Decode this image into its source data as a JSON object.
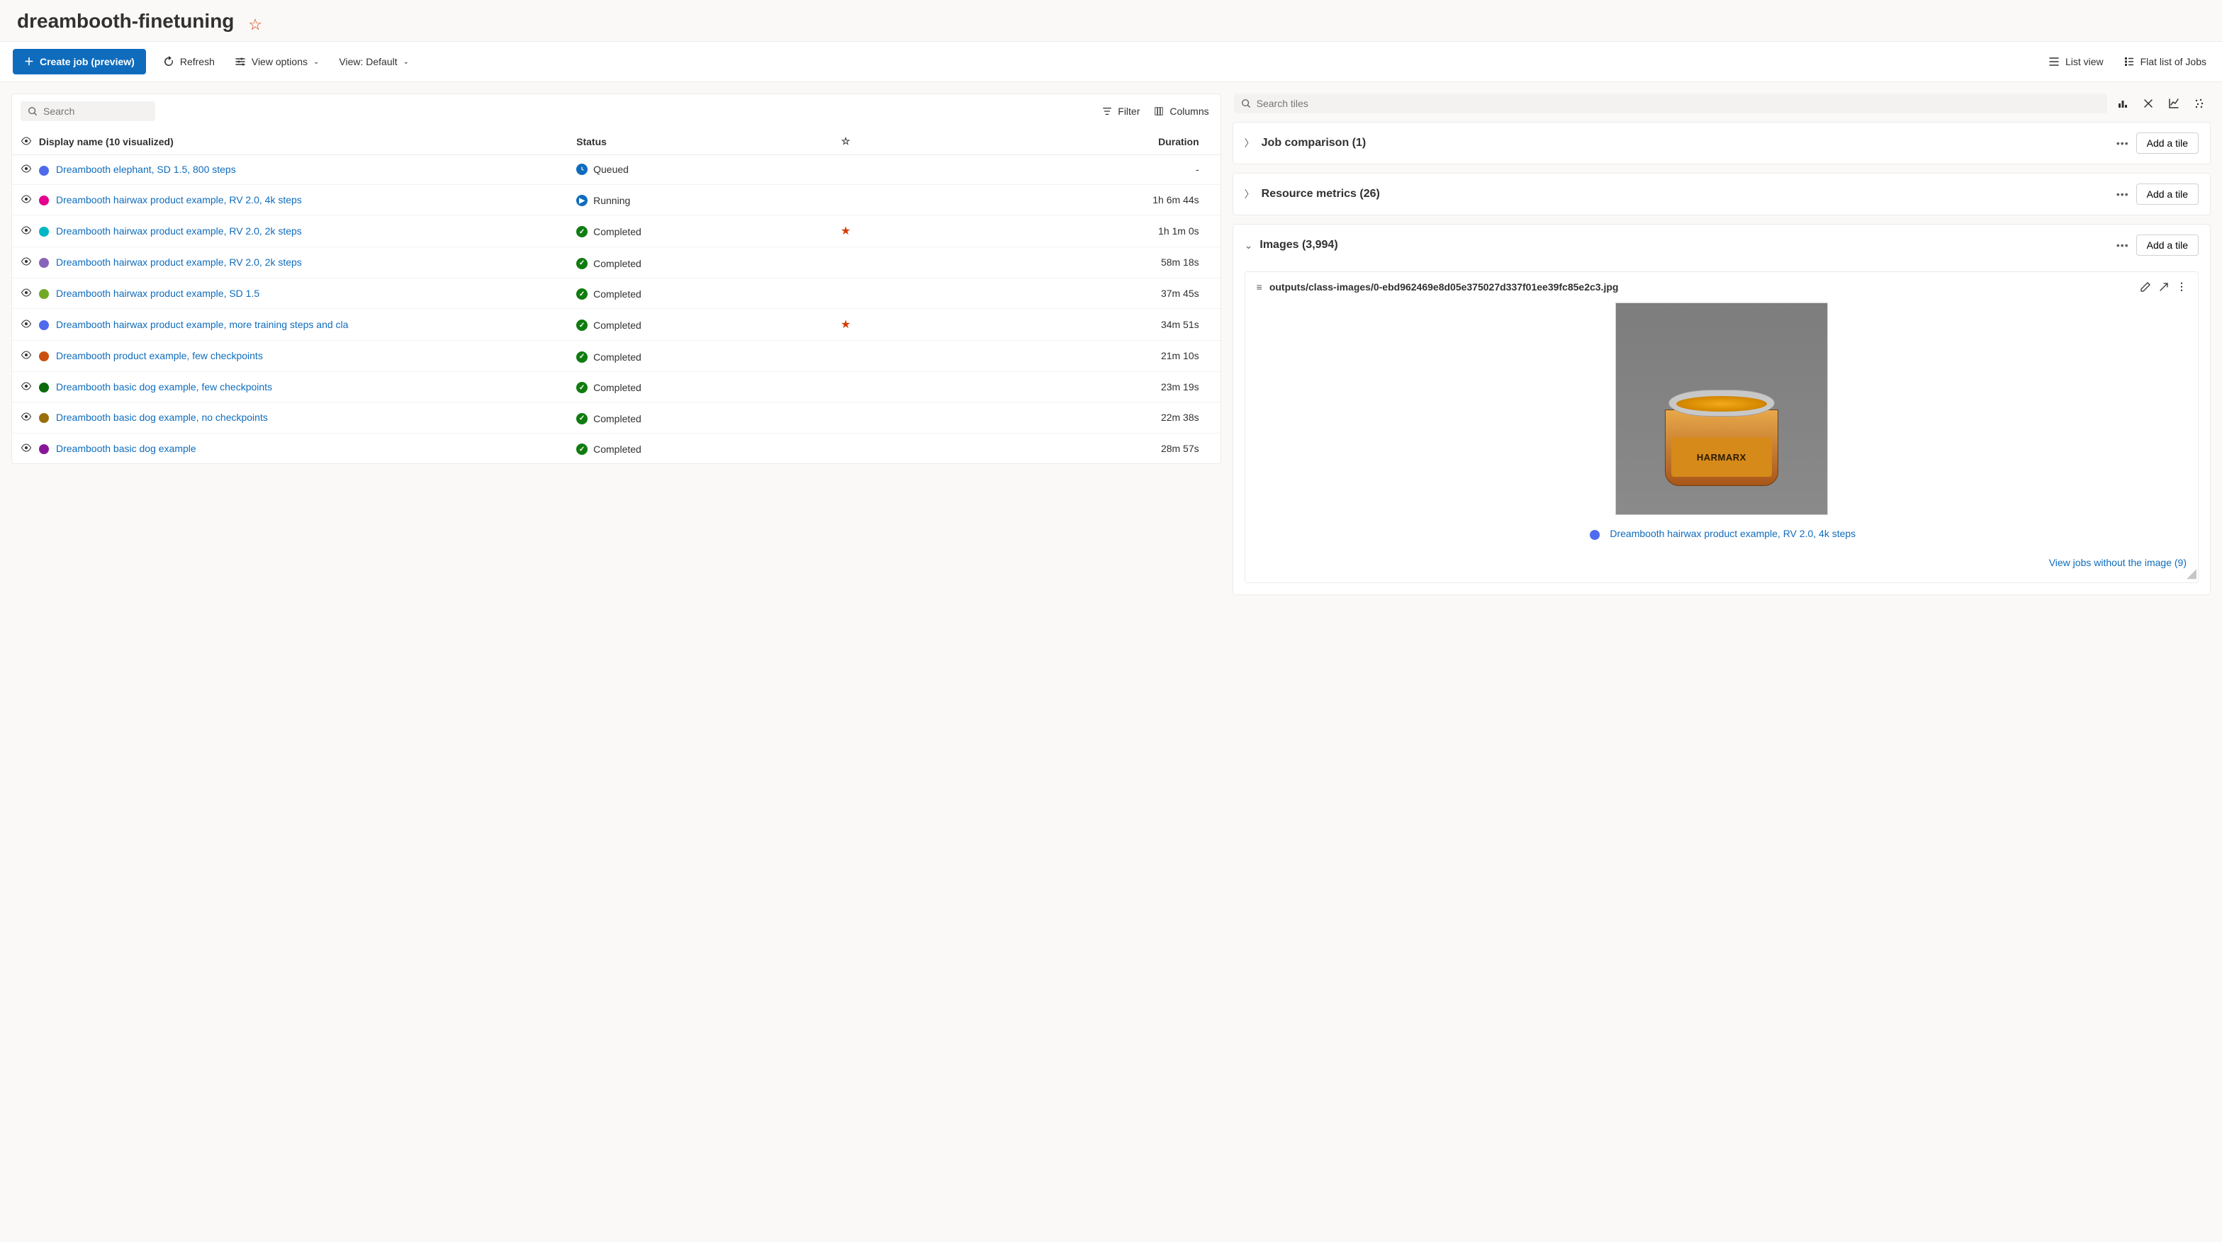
{
  "header": {
    "title": "dreambooth-finetuning"
  },
  "toolbar": {
    "create_job": "Create job (preview)",
    "refresh": "Refresh",
    "view_options": "View options",
    "view_default": "View: Default",
    "list_view": "List view",
    "flat_list": "Flat list of Jobs"
  },
  "left_panel": {
    "search_placeholder": "Search",
    "filter": "Filter",
    "columns": "Columns",
    "col_name": "Display name (10 visualized)",
    "col_status": "Status",
    "col_duration": "Duration"
  },
  "jobs": [
    {
      "color": "#4f6bed",
      "name": "Dreambooth elephant, SD 1.5, 800 steps",
      "status": "Queued",
      "status_type": "queued",
      "starred": false,
      "duration": "-"
    },
    {
      "color": "#e3008c",
      "name": "Dreambooth hairwax product example, RV 2.0, 4k steps",
      "status": "Running",
      "status_type": "running",
      "starred": false,
      "duration": "1h 6m 44s"
    },
    {
      "color": "#00b7c3",
      "name": "Dreambooth hairwax product example, RV 2.0, 2k steps",
      "status": "Completed",
      "status_type": "completed",
      "starred": true,
      "duration": "1h 1m 0s"
    },
    {
      "color": "#8764b8",
      "name": "Dreambooth hairwax product example, RV 2.0, 2k steps",
      "status": "Completed",
      "status_type": "completed",
      "starred": false,
      "duration": "58m 18s"
    },
    {
      "color": "#73aa24",
      "name": "Dreambooth hairwax product example, SD 1.5",
      "status": "Completed",
      "status_type": "completed",
      "starred": false,
      "duration": "37m 45s"
    },
    {
      "color": "#4f6bed",
      "name": "Dreambooth hairwax product example, more training steps and cla",
      "status": "Completed",
      "status_type": "completed",
      "starred": true,
      "duration": "34m 51s"
    },
    {
      "color": "#ca5010",
      "name": "Dreambooth product example, few checkpoints",
      "status": "Completed",
      "status_type": "completed",
      "starred": false,
      "duration": "21m 10s"
    },
    {
      "color": "#0b6a0b",
      "name": "Dreambooth basic dog example, few checkpoints",
      "status": "Completed",
      "status_type": "completed",
      "starred": false,
      "duration": "23m 19s"
    },
    {
      "color": "#986f0b",
      "name": "Dreambooth basic dog example, no checkpoints",
      "status": "Completed",
      "status_type": "completed",
      "starred": false,
      "duration": "22m 38s"
    },
    {
      "color": "#881798",
      "name": "Dreambooth basic dog example",
      "status": "Completed",
      "status_type": "completed",
      "starred": false,
      "duration": "28m 57s"
    }
  ],
  "right": {
    "search_placeholder": "Search tiles",
    "sections": {
      "comparison": "Job comparison (1)",
      "resource": "Resource metrics (26)",
      "images": "Images (3,994)"
    },
    "add_tile": "Add a tile",
    "image_tile": {
      "path": "outputs/class-images/0-ebd962469e8d05e375027d337f01ee39fc85e2c3.jpg",
      "jar_label": "HARMARX",
      "caption": "Dreambooth hairwax product example, RV 2.0, 4k steps",
      "caption_color": "#4f6bed",
      "view_without": "View jobs without the image (9)"
    }
  }
}
